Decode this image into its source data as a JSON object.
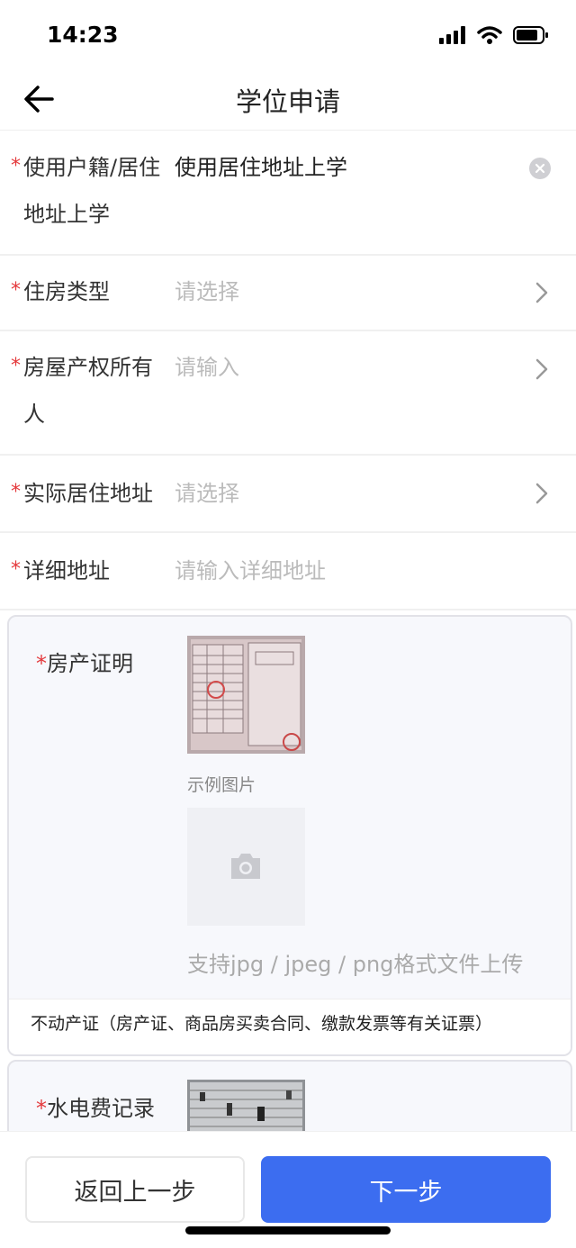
{
  "status": {
    "time": "14:23"
  },
  "header": {
    "title": "学位申请"
  },
  "form": {
    "residence": {
      "required": "*",
      "label": "使用户籍/居住地址上学",
      "value": "使用居住地址上学"
    },
    "housing_type": {
      "required": "*",
      "label": "住房类型",
      "placeholder": "请选择"
    },
    "owner": {
      "required": "*",
      "label": "房屋产权所有人",
      "placeholder": "请输入"
    },
    "actual_address": {
      "required": "*",
      "label": "实际居住地址",
      "placeholder": "请选择"
    },
    "detail_address": {
      "required": "*",
      "label": "详细地址",
      "placeholder": "请输入详细地址"
    }
  },
  "property_card": {
    "required": "*",
    "label": "房产证明",
    "sample_caption": "示例图片",
    "upload_hint": "支持jpg / jpeg / png格式文件上传",
    "note": "不动产证（房产证、商品房买卖合同、缴款发票等有关证票）"
  },
  "utility_card": {
    "required": "*",
    "label": "水电费记录"
  },
  "footer": {
    "prev_label": "返回上一步",
    "next_label": "下一步"
  },
  "colors": {
    "accent": "#3c6df0",
    "required": "#e4393c"
  }
}
